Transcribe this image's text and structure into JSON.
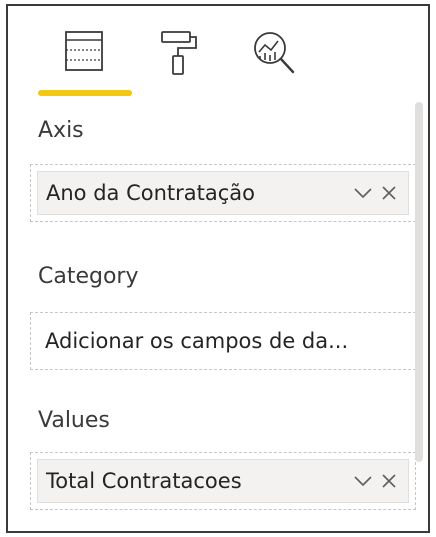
{
  "tabs": [
    {
      "name": "fields",
      "icon": "fields-icon",
      "active": true
    },
    {
      "name": "format",
      "icon": "paint-roller-icon",
      "active": false
    },
    {
      "name": "analytics",
      "icon": "analytics-magnifier-icon",
      "active": false
    }
  ],
  "accent_color": "#f2c811",
  "sections": {
    "axis": {
      "label": "Axis",
      "field": "Ano da Contratação"
    },
    "category": {
      "label": "Category",
      "placeholder": "Adicionar os campos de da..."
    },
    "values": {
      "label": "Values",
      "field": "Total Contratacoes"
    }
  }
}
